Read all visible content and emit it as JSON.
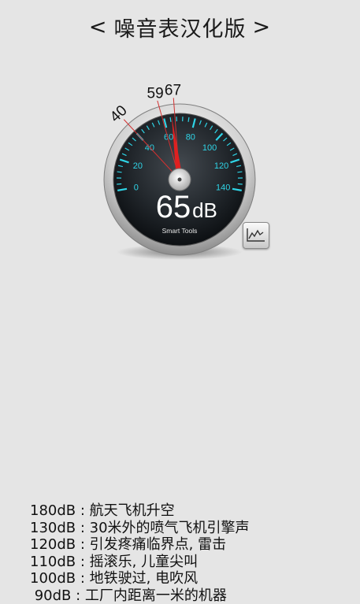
{
  "header": {
    "prev": "<",
    "title": "噪音表汉化版",
    "next": ">"
  },
  "gauge": {
    "value_text": "65",
    "unit": "dB",
    "brand": "Smart Tools",
    "current_db": 65,
    "scale_max": 140,
    "ticks": [
      "0",
      "20",
      "40",
      "60",
      "80",
      "100",
      "120",
      "140"
    ],
    "markers": [
      "40",
      "59",
      "67"
    ],
    "accent_color": "#2fd4e6",
    "needle_color": "#e02020",
    "marker_color": "#d23030"
  },
  "chart_button": {
    "icon": "line-chart-icon"
  },
  "reference": [
    "180dB : 航天飞机升空",
    "130dB : 30米外的喷气飞机引擎声",
    "120dB : 引发疼痛临界点, 雷击",
    "110dB : 摇滚乐, 儿童尖叫",
    "100dB : 地铁驶过, 电吹风",
    " 90dB : 工厂内距离一米的机器"
  ]
}
